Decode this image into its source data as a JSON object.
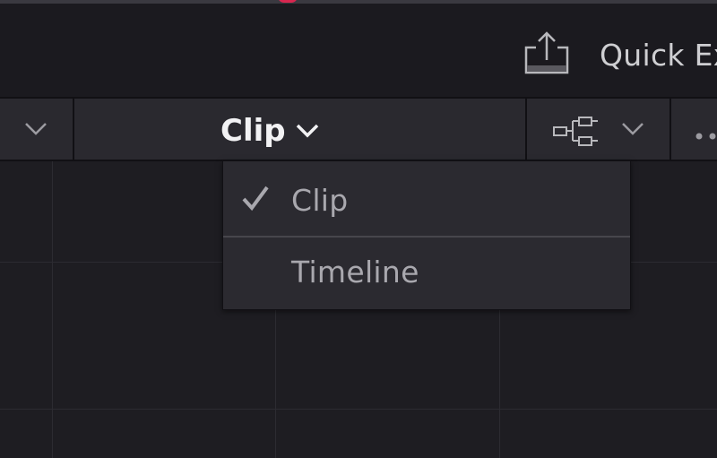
{
  "toolbar": {
    "quick_export_label": "Quick Ex",
    "export_icon": "export-upload-icon"
  },
  "header": {
    "left_dropdown_icon": "chevron-down-icon",
    "mode_selector": {
      "selected": "Clip",
      "icon": "chevron-down-icon"
    },
    "node_graph_icon": "node-graph-icon",
    "node_graph_dropdown_icon": "chevron-down-icon",
    "more_icon": "more-dots-icon"
  },
  "dropdown": {
    "items": [
      {
        "label": "Clip",
        "checked": true
      },
      {
        "label": "Timeline",
        "checked": false
      }
    ]
  },
  "colors": {
    "accent_record": "#d8264f",
    "panel_bg": "#1e1d22",
    "menu_bg": "#2b2a30",
    "selected_text": "#f2f2f4",
    "menu_text": "#a9a8ae"
  }
}
